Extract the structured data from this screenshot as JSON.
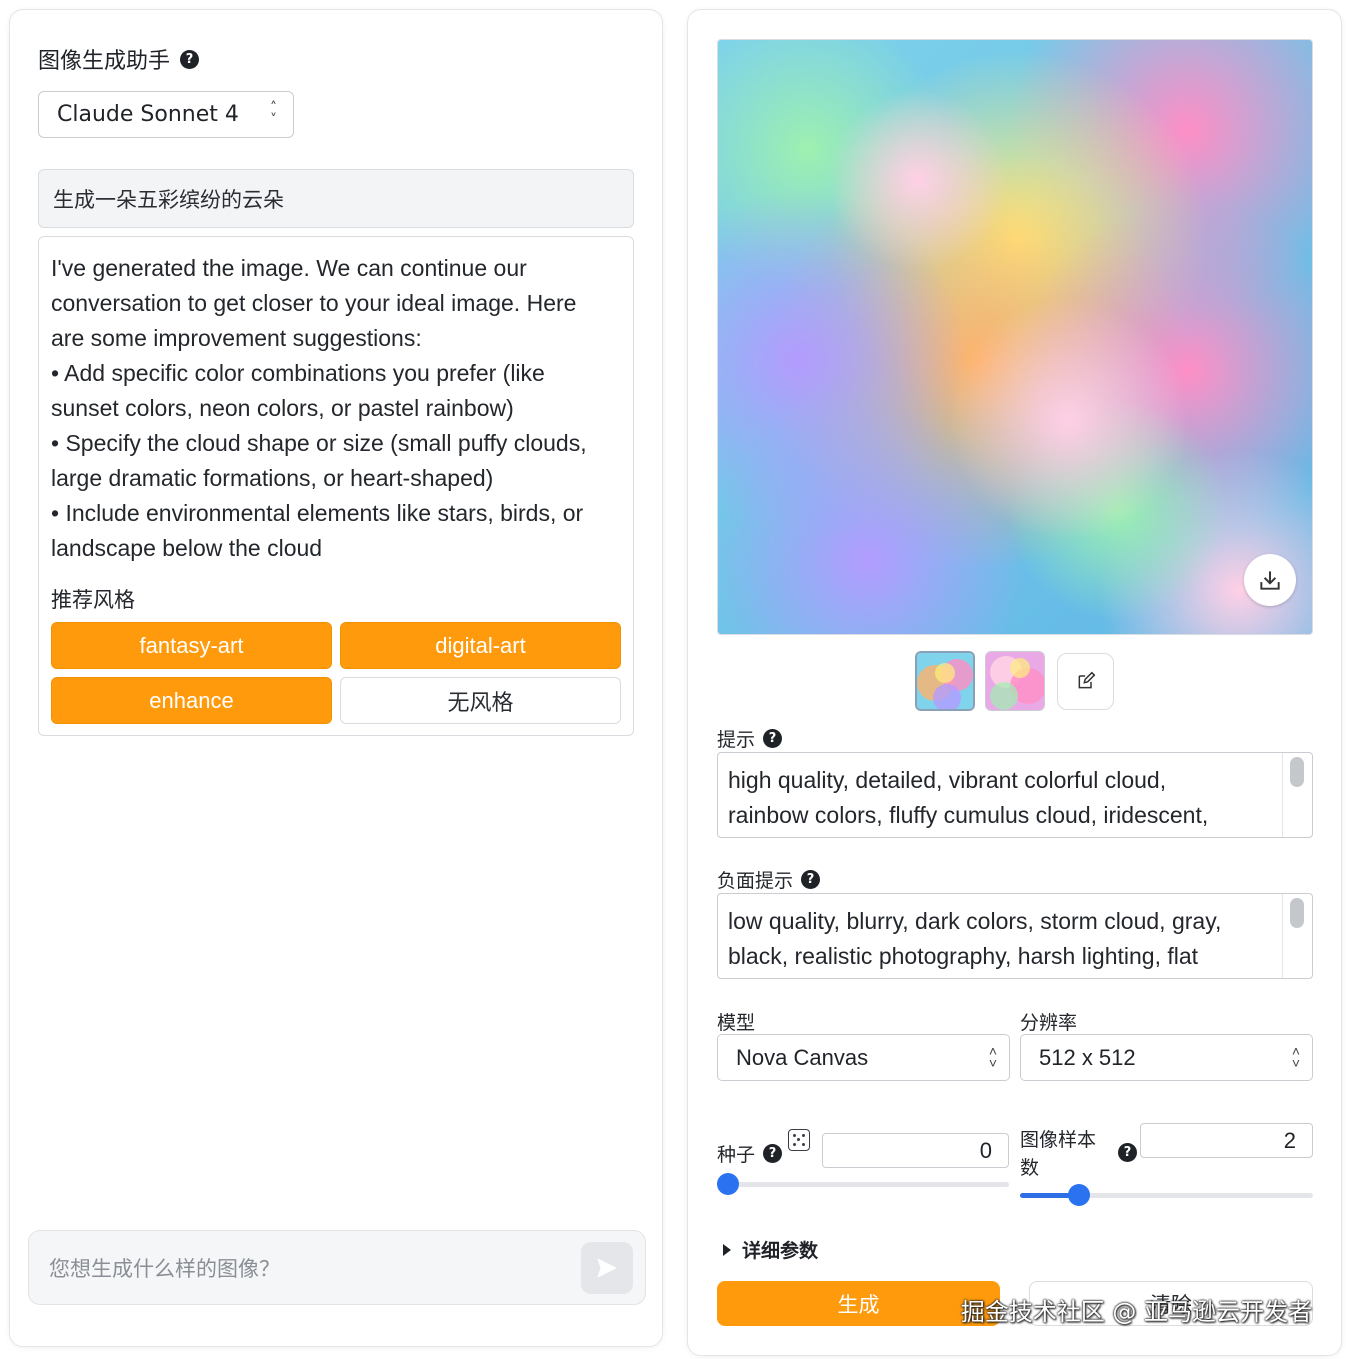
{
  "assistant": {
    "title": "图像生成助手",
    "model": "Claude Sonnet 4"
  },
  "chat": {
    "user_message": "生成一朵五彩缤纷的云朵",
    "reply_lines": [
      "I've generated the image. We can continue our",
      "conversation to get closer to your ideal image. Here",
      "are some improvement suggestions:",
      "• Add specific color combinations you prefer (like",
      "sunset colors, neon colors, or pastel rainbow)",
      "• Specify the cloud shape or size (small puffy clouds,",
      "large dramatic formations, or heart-shaped)",
      "• Include environmental elements like stars, birds, or",
      "landscape below the cloud"
    ],
    "styles_label": "推荐风格",
    "styles": [
      "fantasy-art",
      "digital-art",
      "enhance",
      "无风格"
    ],
    "input_placeholder": "您想生成什么样的图像？"
  },
  "generator": {
    "prompt_label": "提示",
    "prompt_lines": [
      "high quality, detailed, vibrant colorful cloud,",
      "rainbow colors, fluffy cumulus cloud, iridescent,"
    ],
    "negative_label": "负面提示",
    "negative_lines": [
      "low quality, blurry, dark colors, storm cloud, gray,",
      "black, realistic photography, harsh lighting, flat"
    ],
    "model_label": "模型",
    "model_value": "Nova Canvas",
    "resolution_label": "分辨率",
    "resolution_value": "512 x 512",
    "seed_label": "种子",
    "seed_value": "0",
    "seed_slider_fraction": 0.0,
    "samples_label_line1": "图像样本",
    "samples_label_line2": "数",
    "samples_value": "2",
    "samples_slider_fraction": 0.2,
    "details_label": "详细参数",
    "generate_label": "生成",
    "clear_label": "清除"
  },
  "watermark": "掘金技术社区 @ 亚马逊云开发者",
  "icons": {
    "help": "question-circle-icon",
    "download": "download-icon",
    "edit": "edit-icon",
    "dice": "dice-icon",
    "send": "send-icon",
    "caret": "caret-right-icon"
  },
  "colors": {
    "accent": "#ff9a0d",
    "slider": "#2a72ef"
  }
}
